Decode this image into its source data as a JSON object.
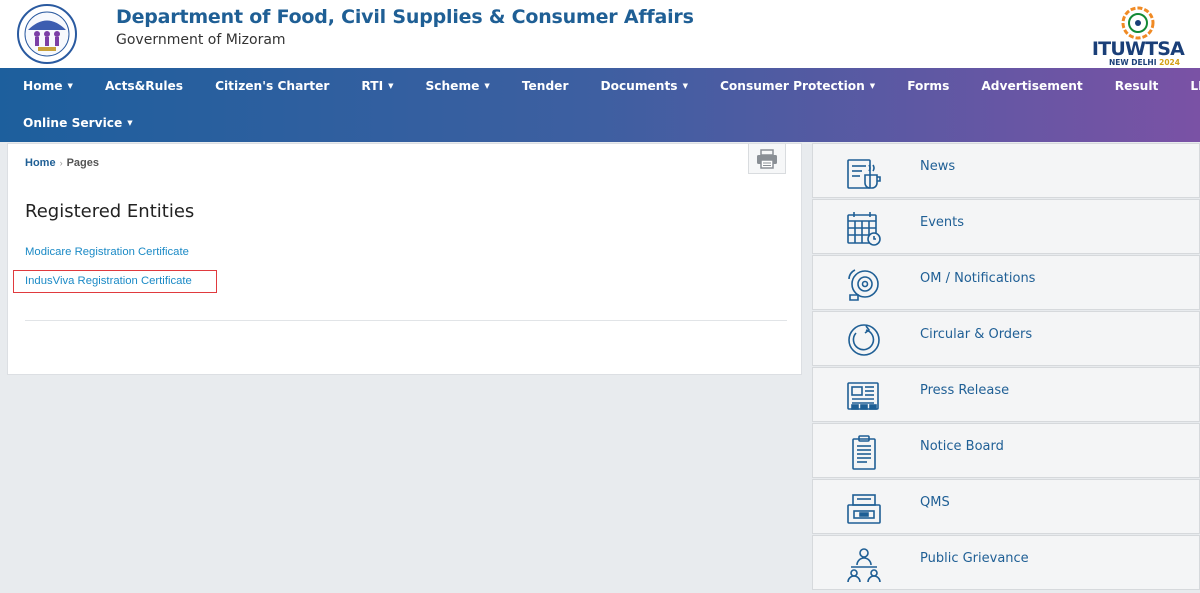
{
  "header": {
    "title": "Department of Food, Civil Supplies & Consumer Affairs",
    "subtitle": "Government of Mizoram",
    "badge": {
      "line1": "ITUWTSA",
      "line2": "NEW DELHI",
      "year": "2024"
    }
  },
  "nav": {
    "row1": [
      {
        "label": "Home",
        "dropdown": true
      },
      {
        "label": "Acts&Rules",
        "dropdown": false
      },
      {
        "label": "Citizen's Charter",
        "dropdown": false
      },
      {
        "label": "RTI",
        "dropdown": true
      },
      {
        "label": "Scheme",
        "dropdown": true
      },
      {
        "label": "Tender",
        "dropdown": false
      },
      {
        "label": "Documents",
        "dropdown": true
      },
      {
        "label": "Consumer Protection",
        "dropdown": true
      },
      {
        "label": "Forms",
        "dropdown": false
      },
      {
        "label": "Advertisement",
        "dropdown": false
      },
      {
        "label": "Result",
        "dropdown": false
      },
      {
        "label": "LPG/POL",
        "dropdown": true
      }
    ],
    "row2": [
      {
        "label": "Online Service",
        "dropdown": true
      }
    ]
  },
  "breadcrumb": {
    "home": "Home",
    "current": "Pages"
  },
  "main": {
    "title": "Registered Entities",
    "links": [
      "Modicare Registration Certificate",
      "IndusViva Registration Certificate"
    ]
  },
  "sidebar": {
    "items": [
      {
        "label": "News",
        "icon": "news-icon"
      },
      {
        "label": "Events",
        "icon": "calendar-icon"
      },
      {
        "label": "OM / Notifications",
        "icon": "bell-icon"
      },
      {
        "label": "Circular & Orders",
        "icon": "circular-icon"
      },
      {
        "label": "Press Release",
        "icon": "newspaper-icon"
      },
      {
        "label": "Notice Board",
        "icon": "clipboard-icon"
      },
      {
        "label": "QMS",
        "icon": "printer-tray-icon"
      },
      {
        "label": "Public Grievance",
        "icon": "people-meeting-icon"
      }
    ]
  },
  "colors": {
    "nav_start": "#1d5f9d",
    "nav_end": "#7a52a5",
    "link": "#1b8ac6",
    "title": "#1f5f95",
    "highlight": "#e03a3e"
  }
}
